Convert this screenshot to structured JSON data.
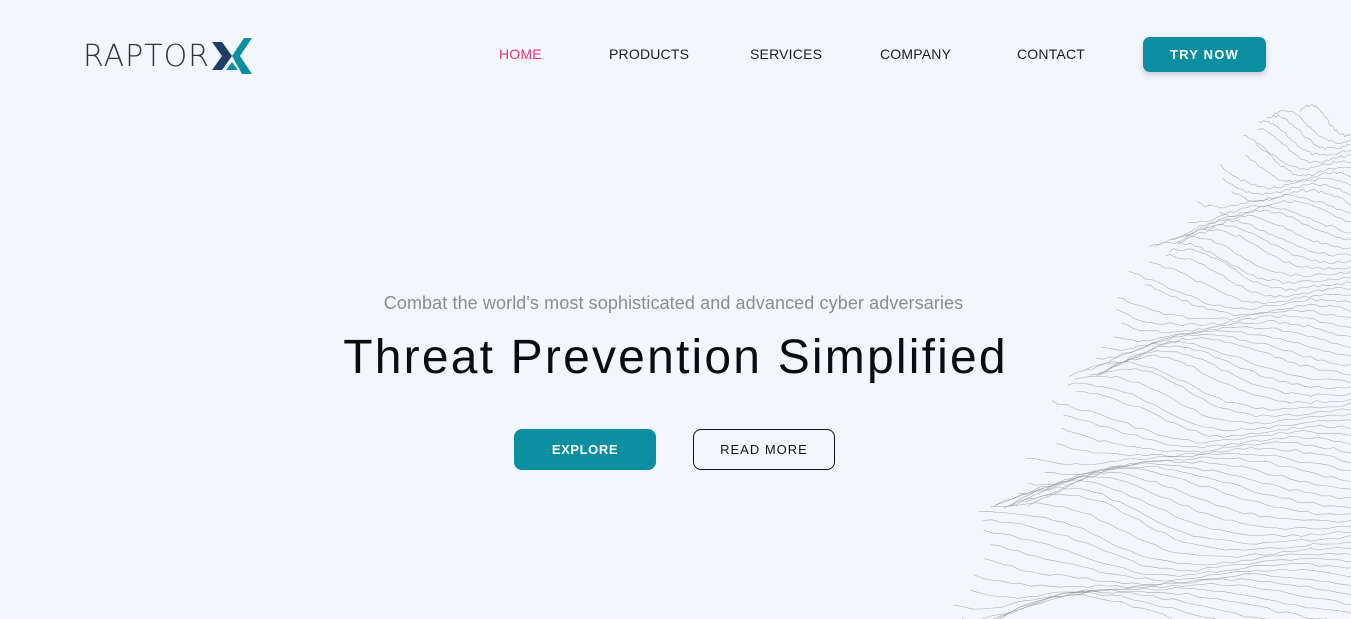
{
  "brand": {
    "name": "RAPTOR",
    "mark": "X",
    "colors": {
      "mark_dark": "#1f3f66",
      "mark_accent": "#0a8ea0"
    }
  },
  "nav": {
    "items": [
      {
        "label": "HOME",
        "active": true
      },
      {
        "label": "PRODUCTS",
        "active": false
      },
      {
        "label": "SERVICES",
        "active": false
      },
      {
        "label": "COMPANY",
        "active": false
      },
      {
        "label": "CONTACT",
        "active": false
      }
    ],
    "cta_label": "TRY NOW"
  },
  "hero": {
    "subtitle": "Combat the world's most sophisticated and advanced cyber adversaries",
    "title": "Threat Prevention Simplified",
    "primary_button": "EXPLORE",
    "secondary_button": "READ MORE"
  },
  "colors": {
    "background": "#f3f6fd",
    "accent": "#0a8ea0",
    "nav_active": "#e8337a"
  },
  "icons": {
    "logo_mark": "raptor-x-logo-icon",
    "background_art": "wireframe-mountain-graphic"
  }
}
